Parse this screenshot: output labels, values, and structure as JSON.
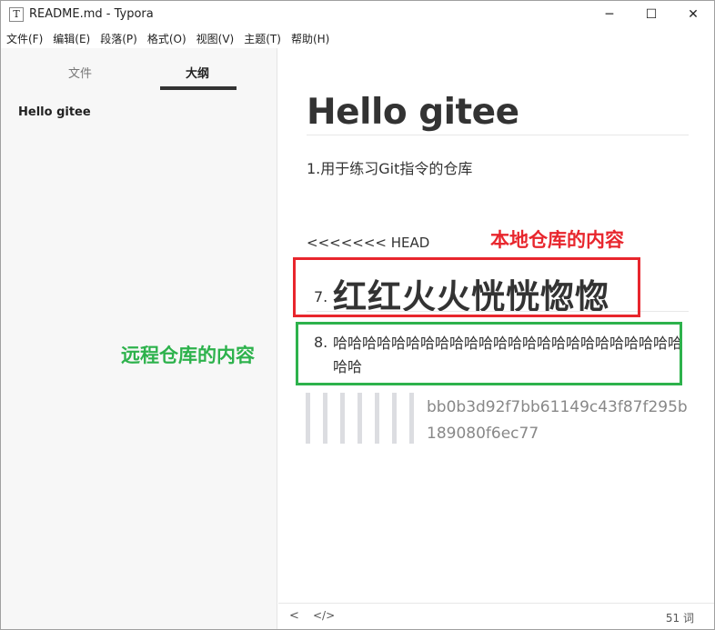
{
  "window": {
    "app_icon_glyph": "T",
    "title": "README.md - Typora",
    "minimize_glyph": "─",
    "maximize_glyph": "☐",
    "close_glyph": "✕"
  },
  "menu": [
    "文件(F)",
    "编辑(E)",
    "段落(P)",
    "格式(O)",
    "视图(V)",
    "主题(T)",
    "帮助(H)"
  ],
  "sidebar": {
    "tabs": [
      {
        "label": "文件"
      },
      {
        "label": "大纲"
      }
    ],
    "active_tab": "大纲",
    "outline": [
      {
        "label": "Hello gitee"
      }
    ]
  },
  "document": {
    "h1": "Hello gitee",
    "para1": "1.用于练习Git指令的仓库",
    "conflict_head": "<<<<<<< HEAD",
    "item7_num": "7.",
    "item7_text": "红红火火恍恍惚惚",
    "item8_num": "8.",
    "item8_text": "哈哈哈哈哈哈哈哈哈哈哈哈哈哈哈哈哈哈哈哈哈哈哈哈哈哈",
    "conflict_hash": "bb0b3d92f7bb61149c43f87f295b189080f6ec77"
  },
  "status": {
    "prev_glyph": "<",
    "source_glyph": "</>",
    "word_count": "51 词"
  },
  "annotations": {
    "local_label": "本地仓库的内容",
    "local_color": "#e8262d",
    "remote_label": "远程仓库的内容",
    "remote_color": "#2db24c"
  }
}
